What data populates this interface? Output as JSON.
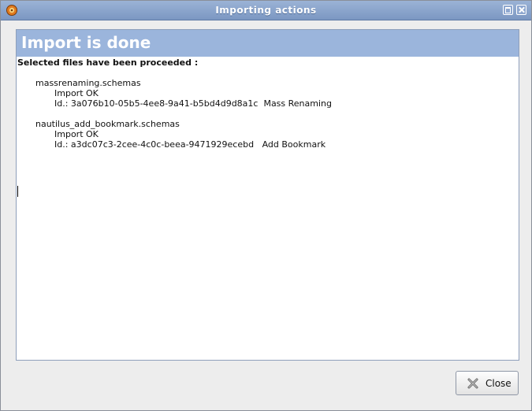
{
  "window": {
    "title": "Importing actions"
  },
  "header": {
    "title": "Import is done"
  },
  "log": {
    "heading": "Selected files have been proceeded :",
    "files": [
      {
        "name": "massrenaming.schemas",
        "status": "Import OK",
        "id_line": "Id.: 3a076b10-05b5-4ee8-9a41-b5bd4d9d8a1c  Mass Renaming"
      },
      {
        "name": "nautilus_add_bookmark.schemas",
        "status": "Import OK",
        "id_line": "Id.: a3dc07c3-2cee-4c0c-beea-9471929ecebd   Add Bookmark"
      }
    ]
  },
  "buttons": {
    "close_label": "Close"
  },
  "colors": {
    "titlebar": "#7b97c2",
    "header_band": "#9bb5dc"
  }
}
